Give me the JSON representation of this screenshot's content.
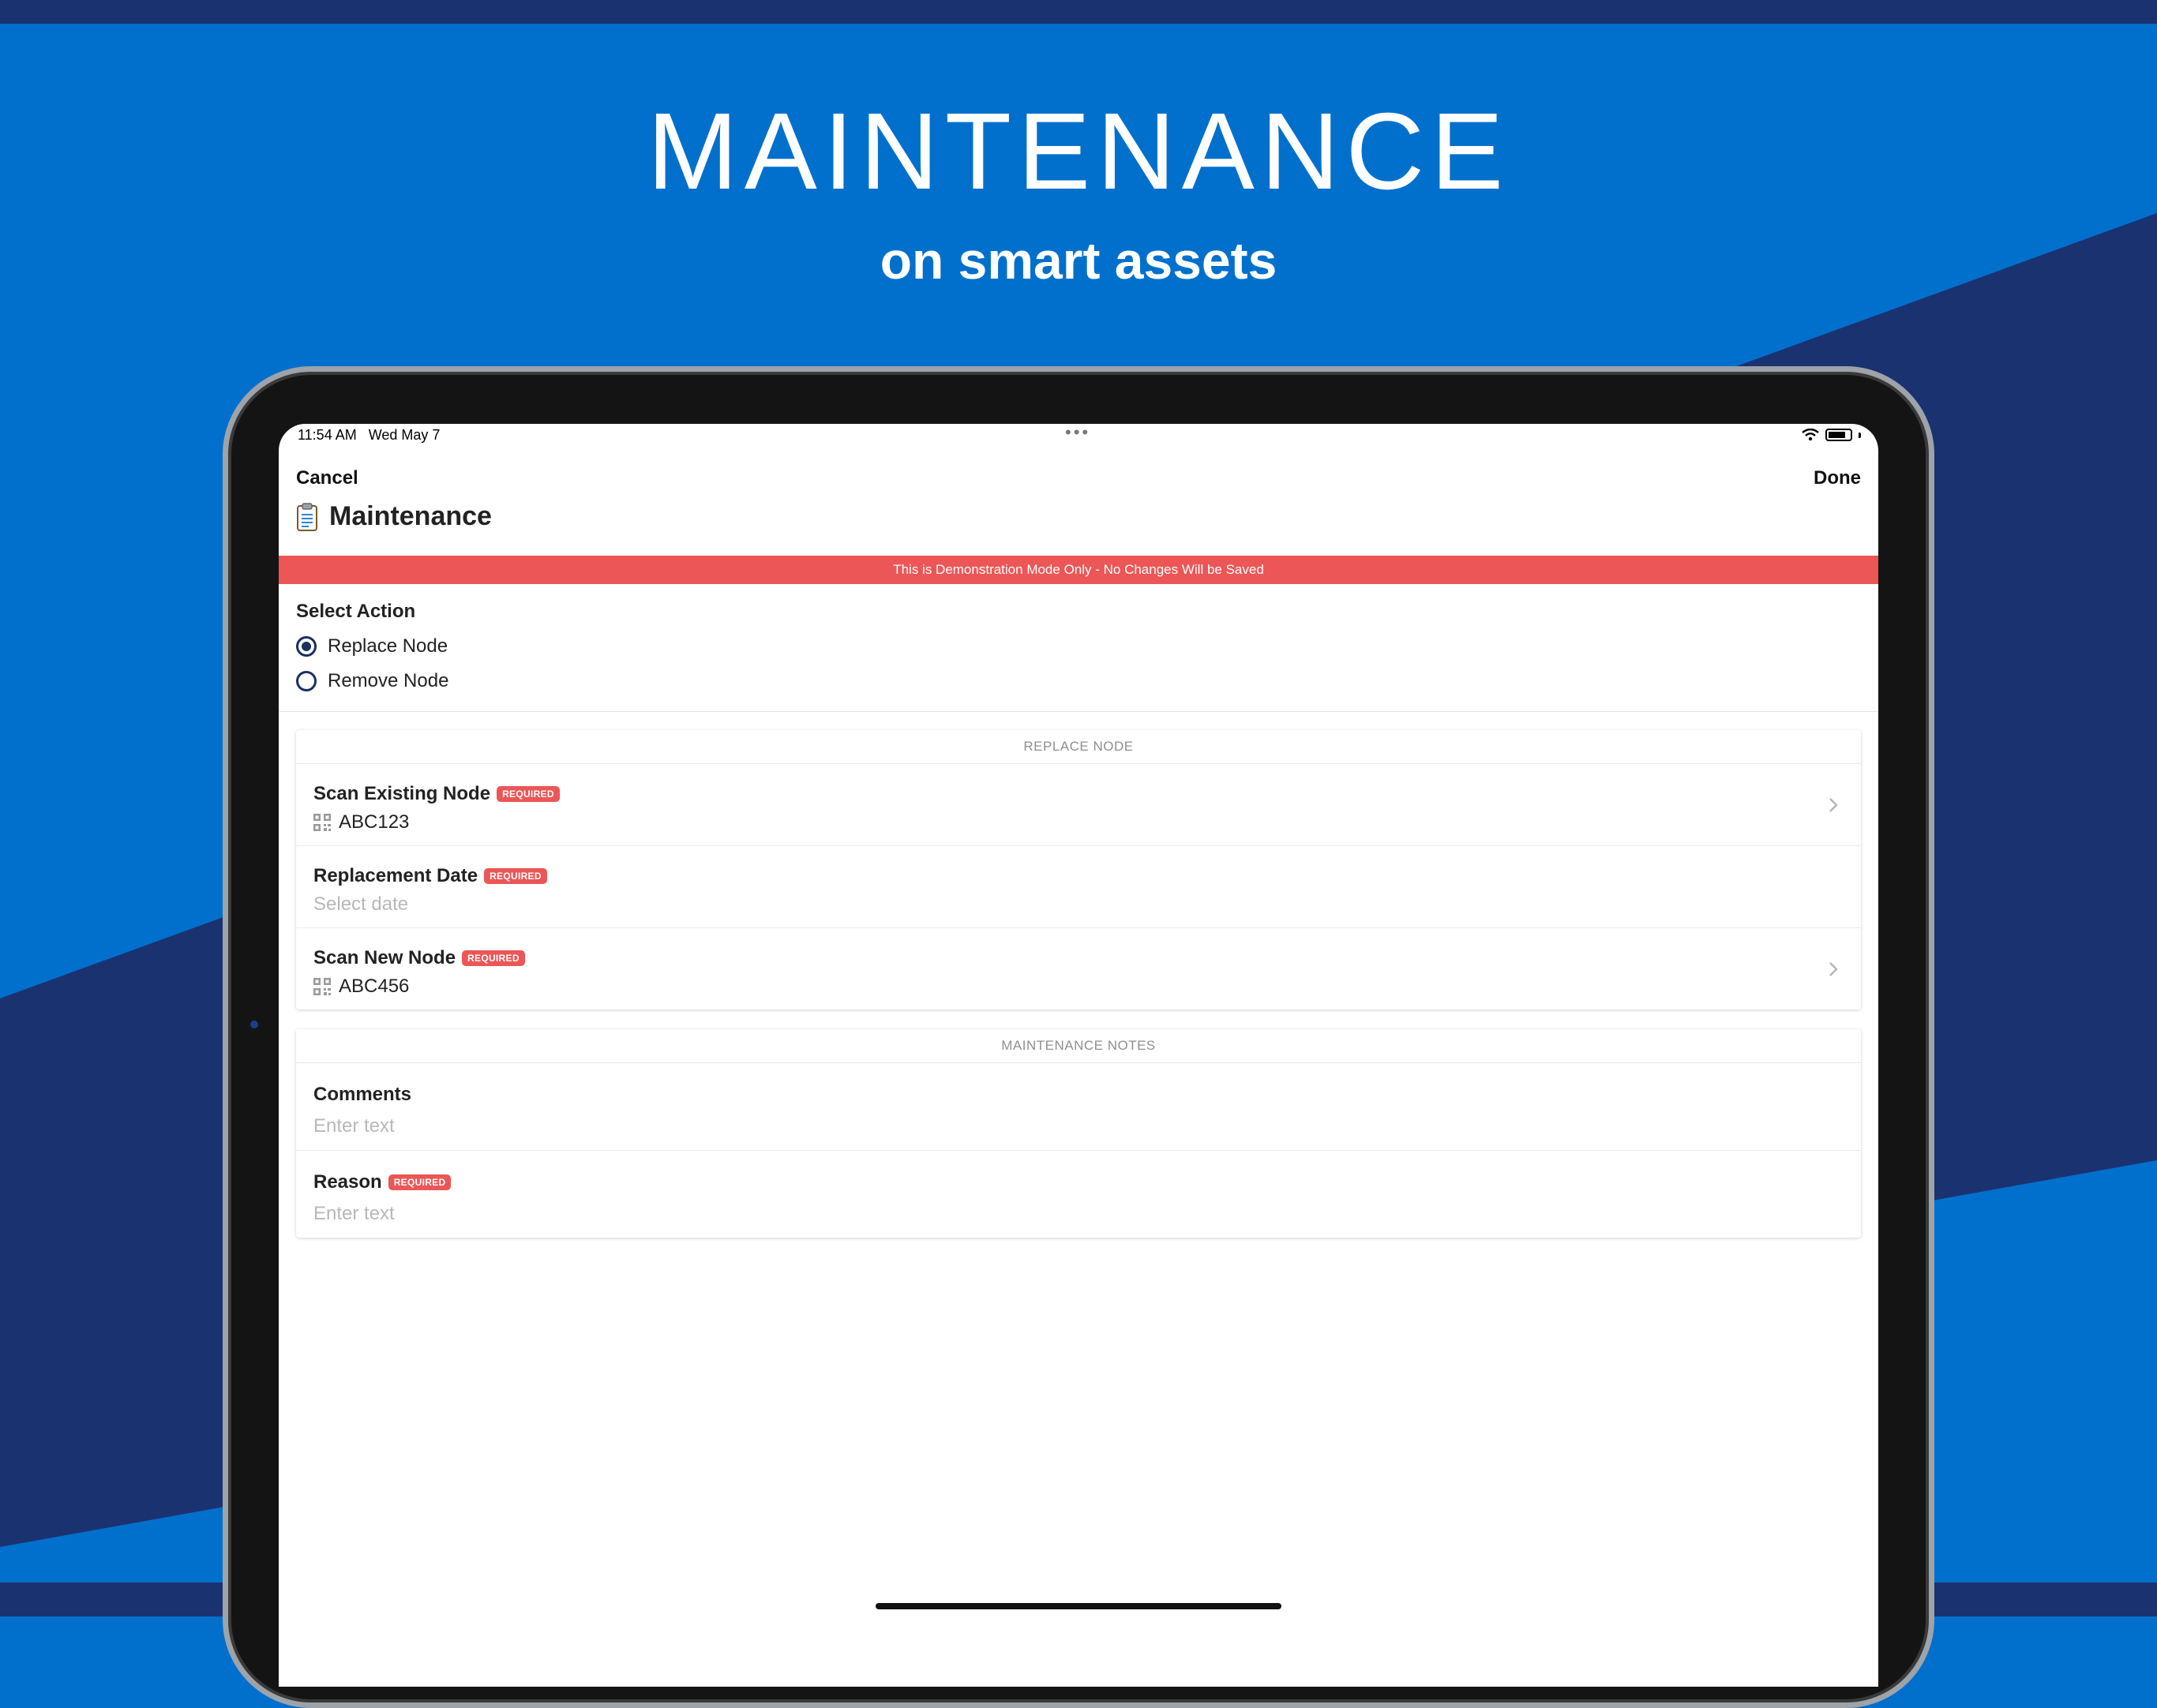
{
  "colors": {
    "background_blue": "#0070cc",
    "background_navy": "#1b3270",
    "banner_red": "#ec5656",
    "radio_navy": "#1b2f60"
  },
  "headline": {
    "title": "MAINTENANCE",
    "subtitle": "on smart assets"
  },
  "status_bar": {
    "time": "11:54 AM   Wed May 7",
    "dots": "•••"
  },
  "nav": {
    "cancel_label": "Cancel",
    "done_label": "Done",
    "title": "Maintenance",
    "title_icon": "clipboard-icon"
  },
  "demo_banner": "This is Demonstration Mode Only - No Changes Will be Saved",
  "select_action": {
    "label": "Select Action",
    "options": [
      {
        "label": "Replace Node",
        "selected": true
      },
      {
        "label": "Remove Node",
        "selected": false
      }
    ]
  },
  "replace_section": {
    "header": "REPLACE NODE",
    "rows": [
      {
        "label": "Scan Existing Node",
        "badge": "REQUIRED",
        "value": "ABC123",
        "icon": "qr-code-icon",
        "chevron": true
      },
      {
        "label": "Replacement Date",
        "badge": "REQUIRED",
        "placeholder": "Select date"
      },
      {
        "label": "Scan New Node",
        "badge": "REQUIRED",
        "value": "ABC456",
        "icon": "qr-code-icon",
        "chevron": true
      }
    ]
  },
  "notes_section": {
    "header": "MAINTENANCE NOTES",
    "rows": [
      {
        "label": "Comments",
        "placeholder": "Enter text"
      },
      {
        "label": "Reason",
        "badge": "REQUIRED",
        "placeholder": "Enter text"
      }
    ]
  }
}
